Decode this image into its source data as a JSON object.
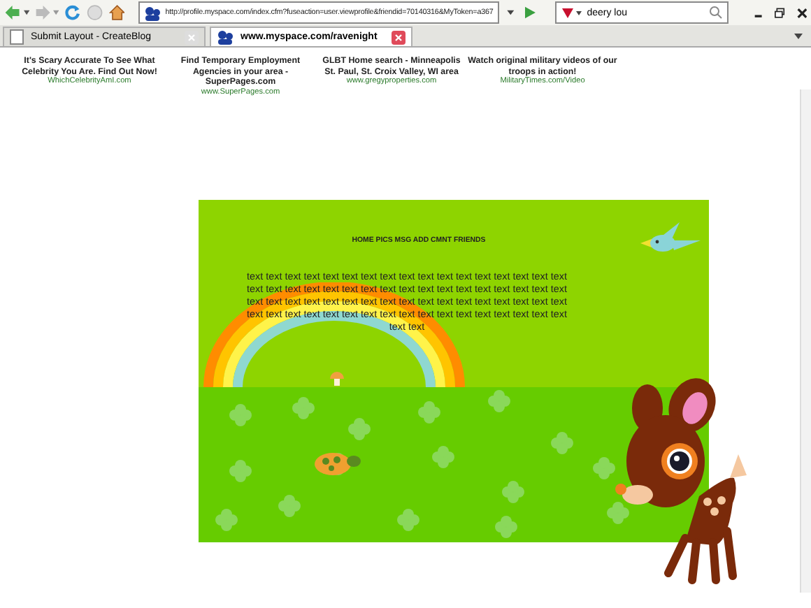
{
  "toolbar": {
    "url": "http://profile.myspace.com/index.cfm?fuseaction=user.viewprofile&friendid=70140316&MyToken=a367",
    "search": "deery lou"
  },
  "tabs": [
    {
      "label": "Submit Layout - CreateBlog",
      "selected": false
    },
    {
      "label": "www.myspace.com/ravenight",
      "selected": true
    }
  ],
  "ads": [
    {
      "text": "It's Scary Accurate To See What Celebrity You Are. Find Out Now!",
      "link": "WhichCelebrityAmI.com"
    },
    {
      "text": "Find Temporary Employment Agencies in your area - SuperPages.com",
      "link": "www.SuperPages.com"
    },
    {
      "text": "GLBT Home search - Minneapolis St. Paul, St. Croix Valley, WI area",
      "link": "www.gregyproperties.com"
    },
    {
      "text": "Watch original military videos of our troops in action!",
      "link": "MilitaryTimes.com/Video"
    }
  ],
  "profile": {
    "nav": "HOME PICS MSG ADD CMNT FRIENDS",
    "body": "text text text text text text text text text text text text text text text text text text text text text text text text text text text text text text text text text text text text text text text text text text text text text text text text text text text text text text text text text text text text text text text text text text text text text text"
  }
}
